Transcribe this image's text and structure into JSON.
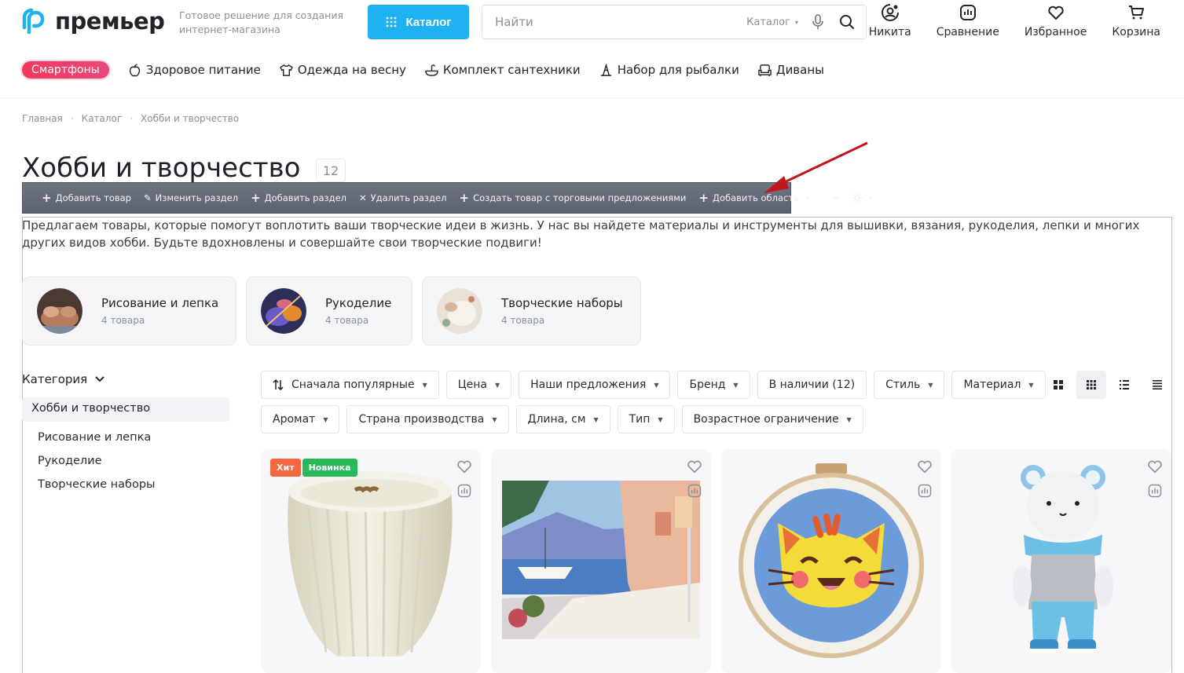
{
  "header": {
    "logo": "премьер",
    "tagline": "Готовое решение для создания интернет-магазина",
    "catalog_button": "Каталог",
    "search": {
      "placeholder": "Найти",
      "scope": "Каталог"
    },
    "icons": [
      {
        "label": "Никита",
        "icon": "user-icon"
      },
      {
        "label": "Сравнение",
        "icon": "compare-icon"
      },
      {
        "label": "Избранное",
        "icon": "heart-icon"
      },
      {
        "label": "Корзина",
        "icon": "cart-icon"
      }
    ]
  },
  "nav": {
    "highlight": "Смартфоны",
    "items": [
      "Здоровое питание",
      "Одежда на весну",
      "Комплект сантехники",
      "Набор для рыбалки",
      "Диваны"
    ]
  },
  "breadcrumb": [
    "Главная",
    "Каталог",
    "Хобби и творчество"
  ],
  "page": {
    "title": "Хобби и творчество",
    "count": "12"
  },
  "admin_toolbar": {
    "items": [
      "Добавить товар",
      "Изменить раздел",
      "Добавить раздел",
      "Удалить раздел",
      "Создать товар с торговыми предложениями",
      "Добавить область"
    ]
  },
  "description": "Предлагаем товары, которые помогут воплотить ваши творческие идеи в жизнь. У нас вы найдете материалы и инструменты для вышивки, вязания, рукоделия, лепки и многих других видов хобби. Будьте вдохновлены и совершайте свои творческие подвиги!",
  "subcategories": [
    {
      "name": "Рисование и лепка",
      "count": "4 товара"
    },
    {
      "name": "Рукоделие",
      "count": "4 товара"
    },
    {
      "name": "Творческие наборы",
      "count": "4 товара"
    }
  ],
  "sidebar": {
    "heading": "Категория",
    "active": "Хобби и творчество",
    "links": [
      "Рисование и лепка",
      "Рукоделие",
      "Творческие наборы"
    ]
  },
  "filters": {
    "sort": "Сначала популярные",
    "row1": [
      "Цена",
      "Наши предложения",
      "Бренд",
      "В наличии (12)",
      "Стиль",
      "Материал"
    ],
    "row2": [
      "Аромат",
      "Страна производства",
      "Длина, см",
      "Тип",
      "Возрастное ограничение"
    ]
  },
  "badges": {
    "hit": "Хит",
    "new": "Новинка"
  },
  "colors": {
    "accent": "#1eb2f0",
    "hit": "#f4683f",
    "new": "#29b85a",
    "admin_bar": "#656b77"
  }
}
